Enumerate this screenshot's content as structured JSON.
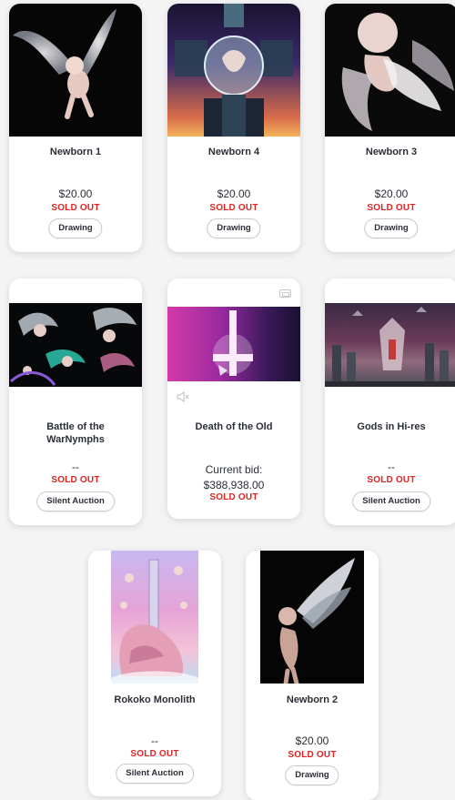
{
  "products": [
    {
      "title": "Newborn 1",
      "price": "$20.00",
      "status": "SOLD OUT",
      "button": "Drawing",
      "art": "winged-baby-black"
    },
    {
      "title": "Newborn 4",
      "price": "$20.00",
      "status": "SOLD OUT",
      "button": "Drawing",
      "art": "robotic-sphere-sunset"
    },
    {
      "title": "Newborn 3",
      "price": "$20.00",
      "status": "SOLD OUT",
      "button": "Drawing",
      "art": "winged-baby-closeup"
    },
    {
      "title": "Battle of the WarNymphs",
      "price": "--",
      "status": "SOLD OUT",
      "button": "Silent Auction",
      "art": "flying-nymphs-battle"
    },
    {
      "title": "Death of the Old",
      "price_label": "Current bid:",
      "price": "$388,938.00",
      "status": "SOLD OUT",
      "art": "glowing-cross-pink",
      "has_video": true
    },
    {
      "title": "Gods in Hi-res",
      "price": "--",
      "status": "SOLD OUT",
      "button": "Silent Auction",
      "art": "ruins-temple-pink-sky"
    },
    {
      "title": "Rokoko Monolith",
      "price": "--",
      "status": "SOLD OUT",
      "button": "Silent Auction",
      "art": "pink-monolith-cherubs"
    },
    {
      "title": "Newborn 2",
      "price": "$20.00",
      "status": "SOLD OUT",
      "button": "Drawing",
      "art": "winged-baby-profile"
    }
  ],
  "icons": {
    "gallery": "gallery-icon",
    "mute": "mute-icon"
  },
  "colors": {
    "sold_out": "#e02323",
    "card_bg": "#ffffff",
    "page_bg": "#f4f4f5"
  }
}
